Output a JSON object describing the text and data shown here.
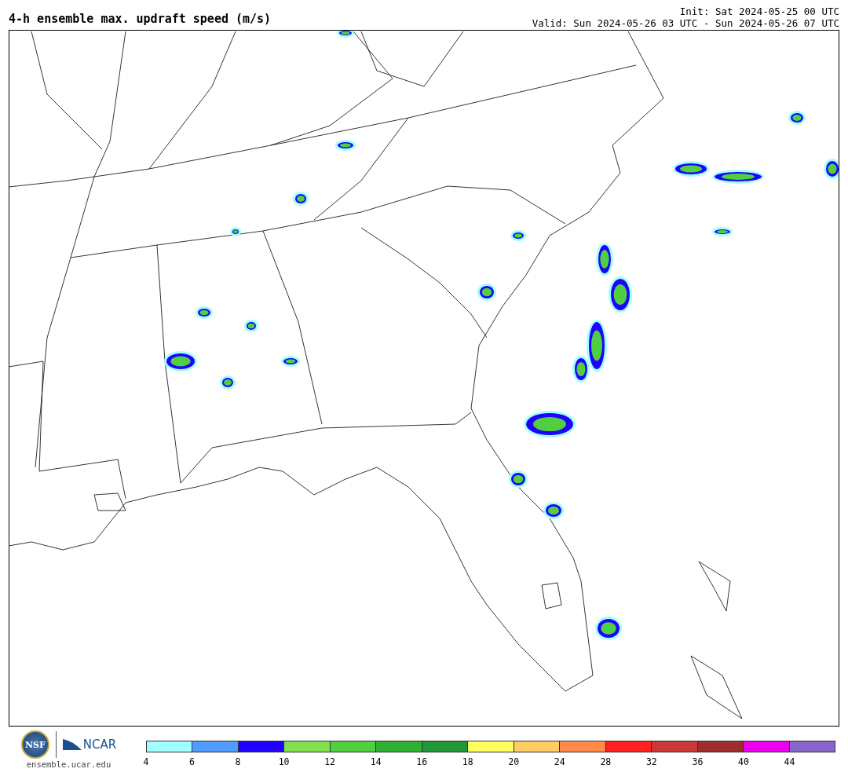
{
  "header": {
    "title": "4-h ensemble max. updraft speed (m/s)",
    "init": "Init: Sat 2024-05-25 00 UTC",
    "valid": "Valid: Sun 2024-05-26 03 UTC - Sun 2024-05-26 07 UTC"
  },
  "footer": {
    "nsf_logo_text": "NSF",
    "ncar_logo_text": "NCAR",
    "site": "ensemble.ucar.edu"
  },
  "legend": {
    "segments": [
      {
        "color": "#a0ffff"
      },
      {
        "color": "#4f9bff"
      },
      {
        "color": "#2000ff"
      },
      {
        "color": "#80e050"
      },
      {
        "color": "#50d040"
      },
      {
        "color": "#30b030"
      },
      {
        "color": "#209838"
      },
      {
        "color": "#ffff60"
      },
      {
        "color": "#ffcc66"
      },
      {
        "color": "#ff8a4a"
      },
      {
        "color": "#ff2020"
      },
      {
        "color": "#cc3838"
      },
      {
        "color": "#a02c2c"
      },
      {
        "color": "#ee00ee"
      },
      {
        "color": "#8866cc"
      }
    ],
    "ticks": [
      "4",
      "6",
      "8",
      "10",
      "12",
      "14",
      "16",
      "18",
      "20",
      "24",
      "28",
      "32",
      "36",
      "40",
      "44"
    ]
  }
}
